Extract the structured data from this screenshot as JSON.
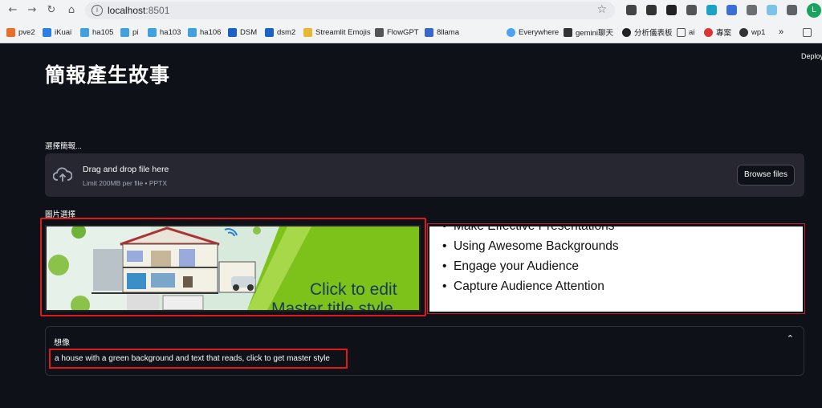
{
  "browser": {
    "url_host": "localhost",
    "url_port": ":8501",
    "bookmarks": [
      "pve2",
      "iKuai",
      "ha105",
      "pi",
      "ha103",
      "ha106",
      "DSM",
      "dsm2",
      "Streamlit Emojis",
      "FlowGPT",
      "8llama",
      "Everywhere",
      "gemini聊天",
      "分析儀表板",
      "ai",
      "專案",
      "wp1"
    ],
    "more": "»",
    "avatar_letter": "L"
  },
  "app": {
    "deploy_label": "Deploy",
    "page_title": "簡報產生故事",
    "uploader_label": "選擇簡報...",
    "dropzone_title": "Drag and drop file here",
    "dropzone_sub": "Limit 200MB per file • PPTX",
    "browse_label": "Browse files",
    "images_label": "圖片選擇",
    "slide1": {
      "text_line1": "Click to edit",
      "text_line2": "Master title style"
    },
    "slide2": {
      "bullets": [
        "Make Effective Presentations",
        "Using Awesome Backgrounds",
        "Engage your Audience",
        "Capture Audience Attention"
      ]
    },
    "expander": {
      "title": "想像",
      "caption": "a house with a green background and text that reads, click to get master style"
    }
  }
}
